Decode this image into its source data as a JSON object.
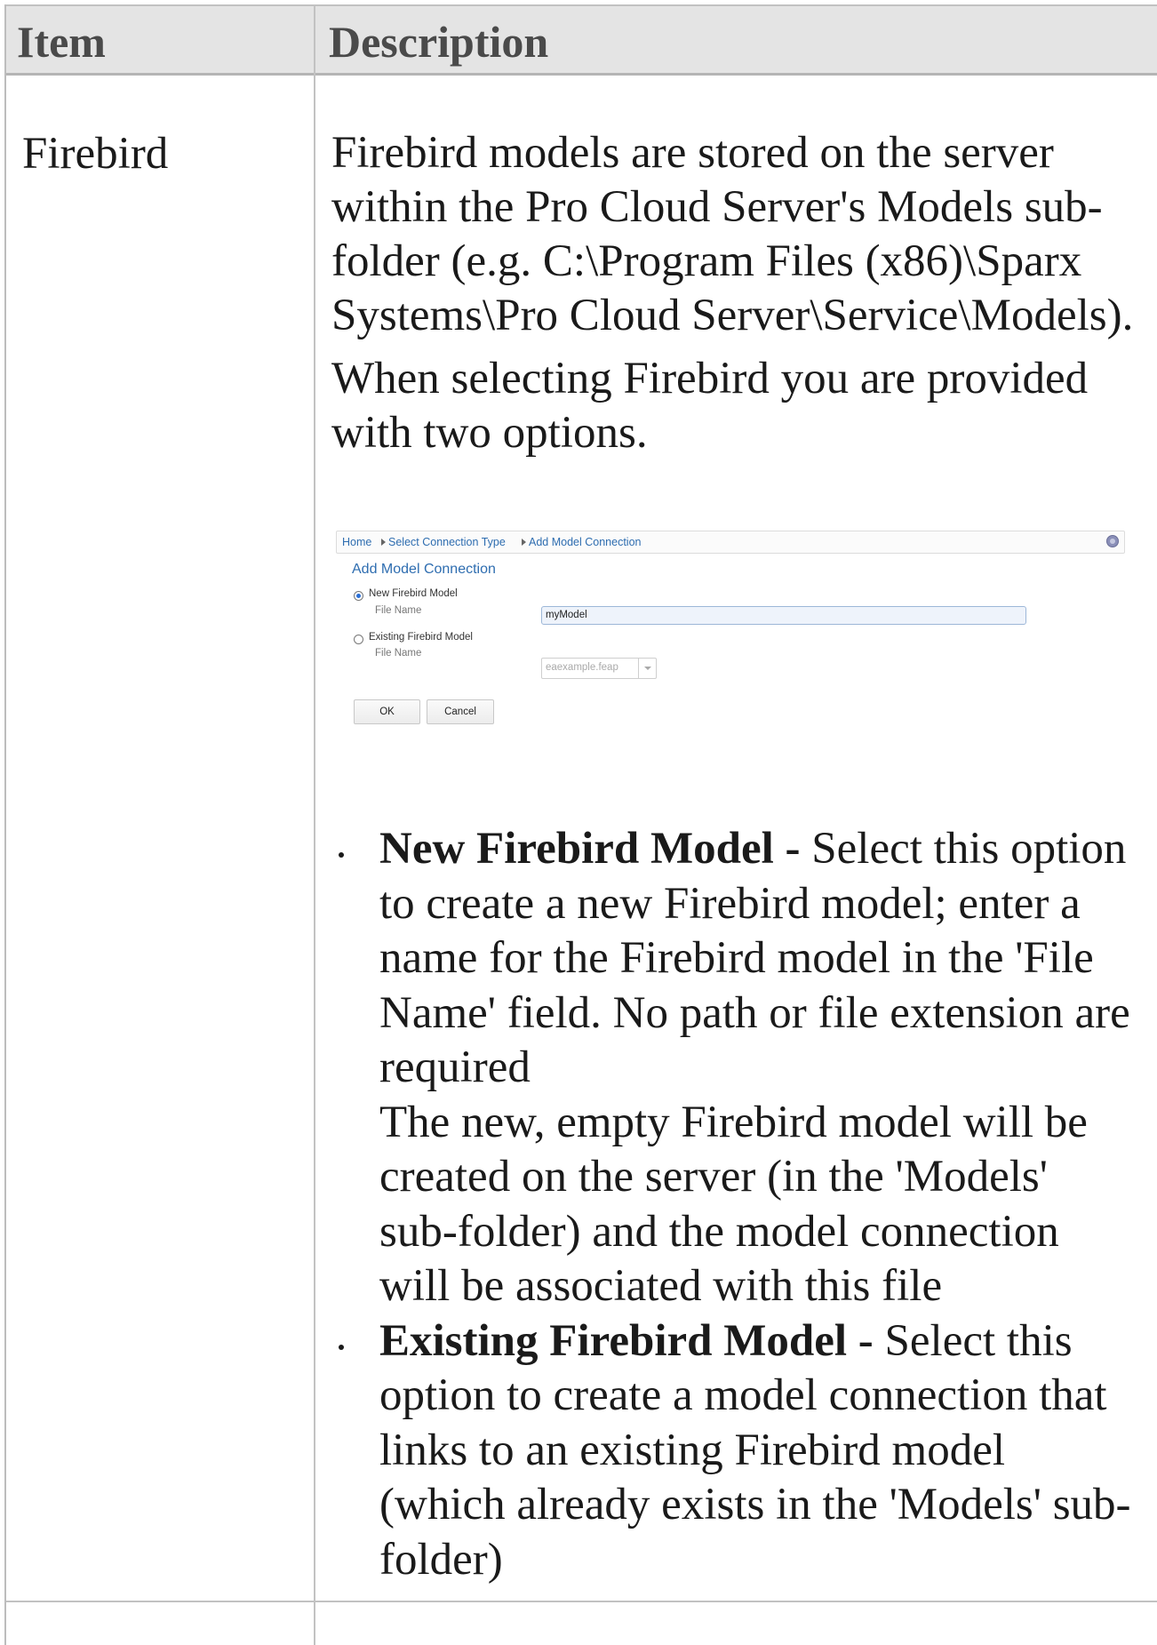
{
  "table": {
    "headers": [
      "Item",
      "Description"
    ],
    "row": {
      "item": "Firebird",
      "description": [
        "Firebird models are stored on the server within the Pro Cloud Server's Models sub-folder (e.g. C:\\Program Files (x86)\\Sparx Systems\\Pro Cloud Server\\Service\\Models).",
        "When selecting Firebird you are provided with two options."
      ],
      "bullets": [
        {
          "term": "New Firebird Model - ",
          "text": "Select this option to create a new Firebird model; enter a name for the Firebird model in the 'File Name' field. No path or file extension are required",
          "extra": "The new, empty Firebird model will be created on the server (in the 'Models' sub-folder) and the model connection will be associated with this file"
        },
        {
          "term": "Existing Firebird Model - ",
          "text": "Select this option to create a model connection that links to an existing Firebird model (which already exists in the 'Models' sub-folder)"
        }
      ]
    }
  },
  "dialog": {
    "breadcrumbs": [
      "Home",
      "Select Connection Type",
      "Add Model Connection"
    ],
    "help_icon": "help-icon",
    "title": "Add Model Connection",
    "options": [
      {
        "label": "New Firebird Model",
        "selected": true,
        "field_label": "File Name",
        "value": "myModel"
      },
      {
        "label": "Existing Firebird Model",
        "selected": false,
        "field_label": "File Name",
        "value": "eaexample.feap"
      }
    ],
    "ok_label": "OK",
    "cancel_label": "Cancel"
  }
}
